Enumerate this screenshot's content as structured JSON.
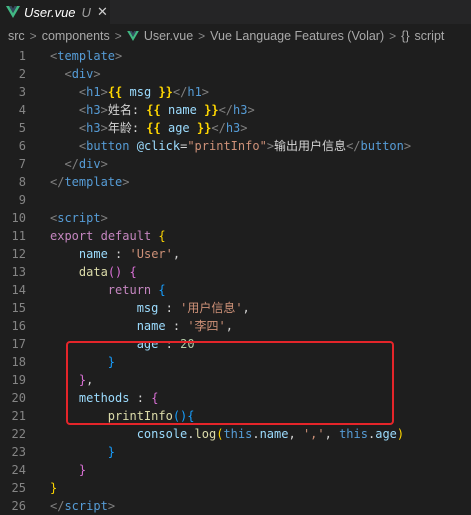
{
  "tab": {
    "filename": "User.vue",
    "modified_marker": "U",
    "close_glyph": "✕"
  },
  "breadcrumb": {
    "segments": [
      "src",
      "components",
      "User.vue",
      "Vue Language Features (Volar)",
      "script"
    ],
    "braces": "{}"
  },
  "line_numbers": [
    "1",
    "2",
    "3",
    "4",
    "5",
    "6",
    "7",
    "8",
    "9",
    "10",
    "11",
    "12",
    "13",
    "14",
    "15",
    "16",
    "17",
    "18",
    "19",
    "20",
    "21",
    "22",
    "23",
    "24",
    "25",
    "26"
  ],
  "code": {
    "l1": "template",
    "l2": "div",
    "l3_tag": "h1",
    "l3_var": "msg",
    "l3_close": "h1",
    "l4_tag": "h3",
    "l4_label": "姓名:",
    "l4_var": "name",
    "l4_close": "h3",
    "l5_tag": "h3",
    "l5_label": "年龄:",
    "l5_var": "age",
    "l5_close": "h3",
    "l6_tag": "button",
    "l6_attr": "@click",
    "l6_value": "\"printInfo\"",
    "l6_text": "输出用户信息",
    "l6_close": "button",
    "l7": "div",
    "l8": "template",
    "l10": "script",
    "l11_kw1": "export",
    "l11_kw2": "default",
    "l12_key": "name",
    "l12_val": "'User'",
    "l13_fn": "data",
    "l14_kw": "return",
    "l15_key": "msg",
    "l15_val": "'用户信息'",
    "l16_key": "name",
    "l16_val": "'李四'",
    "l17_key": "age",
    "l17_val": "20",
    "l20_key": "methods",
    "l21_fn": "printInfo",
    "l22_obj": "console",
    "l22_fn": "log",
    "l22_this1": "this",
    "l22_p1": "name",
    "l22_str": "','",
    "l22_this2": "this",
    "l22_p2": "age",
    "l26": "script"
  },
  "colors": {
    "highlight_box": "#e5252a",
    "background": "#1e1e1e"
  }
}
